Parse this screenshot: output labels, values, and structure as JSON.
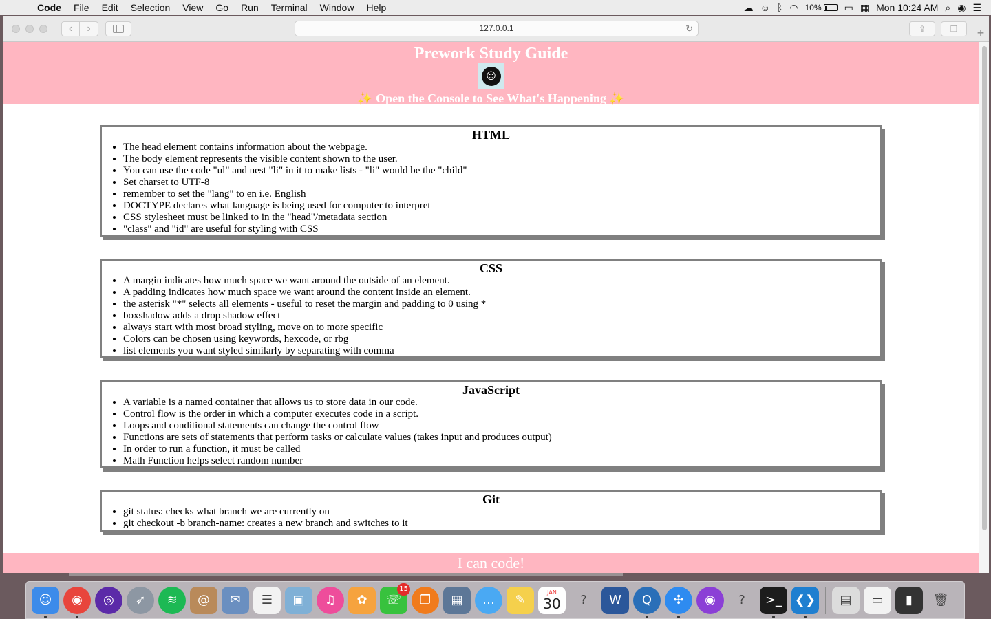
{
  "menubar": {
    "app_name": "Code",
    "menus": [
      "File",
      "Edit",
      "Selection",
      "View",
      "Go",
      "Run",
      "Terminal",
      "Window",
      "Help"
    ],
    "battery": "10%",
    "clock": "Mon 10:24 AM"
  },
  "browser": {
    "url": "127.0.0.1"
  },
  "page": {
    "title": "Prework Study Guide",
    "subtitle": "✨ Open the Console to See What's Happening ✨",
    "avatar_glyph": "☺",
    "sections": [
      {
        "heading": "HTML",
        "items": [
          "The head element contains information about the webpage.",
          "The body element represents the visible content shown to the user.",
          "You can use the code \"ul\" and nest \"li\" in it to make lists - \"li\" would be the \"child\"",
          "Set charset to UTF-8",
          "remember to set the \"lang\" to en i.e. English",
          "DOCTYPE declares what language is being used for computer to interpret",
          "CSS stylesheet must be linked to in the \"head\"/metadata section",
          "\"class\" and \"id\" are useful for styling with CSS"
        ]
      },
      {
        "heading": "CSS",
        "items": [
          "A margin indicates how much space we want around the outside of an element.",
          "A padding indicates how much space we want around the content inside an element.",
          "the asterisk \"*\" selects all elements - useful to reset the margin and padding to 0 using *",
          "boxshadow adds a drop shadow effect",
          "always start with most broad styling, move on to more specific",
          "Colors can be chosen using keywords, hexcode, or rbg",
          "list elements you want styled similarly by separating with comma"
        ]
      },
      {
        "heading": "JavaScript",
        "items": [
          "A variable is a named container that allows us to store data in our code.",
          "Control flow is the order in which a computer executes code in a script.",
          "Loops and conditional statements can change the control flow",
          "Functions are sets of statements that perform tasks or calculate values (takes input and produces output)",
          "In order to run a function, it must be called",
          "Math Function helps select random number"
        ]
      },
      {
        "heading": "Git",
        "items": [
          "git status: checks what branch we are currently on",
          "git checkout -b branch-name: creates a new branch and switches to it"
        ]
      }
    ],
    "footer": "I can code!"
  },
  "dock": {
    "messages_badge": "15",
    "calendar_month": "JAN",
    "calendar_day": "30",
    "items": [
      {
        "name": "finder-icon",
        "glyph": "☺",
        "bg": "#3c8bea",
        "running": true
      },
      {
        "name": "chrome-icon",
        "glyph": "◉",
        "bg": "#e8453c",
        "running": true,
        "round": true
      },
      {
        "name": "siri-icon",
        "glyph": "◎",
        "bg": "#5b2aa8",
        "running": false,
        "round": true
      },
      {
        "name": "launchpad-icon",
        "glyph": "➶",
        "bg": "#8d97a3",
        "running": false,
        "round": true
      },
      {
        "name": "spotify-icon",
        "glyph": "≋",
        "bg": "#1db954",
        "running": false,
        "round": true
      },
      {
        "name": "contacts-icon",
        "glyph": "@",
        "bg": "#b98a5a",
        "running": false
      },
      {
        "name": "mail-icon",
        "glyph": "✉",
        "bg": "#6a8fc0",
        "running": false
      },
      {
        "name": "reminders-icon",
        "glyph": "☰",
        "bg": "#f2f2f2",
        "running": false
      },
      {
        "name": "preview-icon",
        "glyph": "▣",
        "bg": "#7fb0d6",
        "running": false
      },
      {
        "name": "itunes-icon",
        "glyph": "♫",
        "bg": "#ee4d9b",
        "running": false,
        "round": true
      },
      {
        "name": "photos-icon",
        "glyph": "✿",
        "bg": "#f6a33e",
        "running": false
      },
      {
        "name": "messages-icon",
        "glyph": "☏",
        "bg": "#38c23e",
        "running": false
      },
      {
        "name": "ibooks-icon",
        "glyph": "❐",
        "bg": "#f07b1c",
        "running": false,
        "round": true
      },
      {
        "name": "image-capture-icon",
        "glyph": "▦",
        "bg": "#5d7797",
        "running": false
      },
      {
        "name": "messages-bubble-icon",
        "glyph": "…",
        "bg": "#4aa9f3",
        "running": false,
        "round": true
      },
      {
        "name": "notes-icon",
        "glyph": "✎",
        "bg": "#f5d04c",
        "running": false
      },
      {
        "name": "calendar-icon",
        "glyph": "",
        "bg": "#ffffff",
        "running": false
      },
      {
        "name": "unknown-app-icon",
        "glyph": "?",
        "bg": "transparent",
        "running": false
      },
      {
        "name": "word-icon",
        "glyph": "W",
        "bg": "#2b579a",
        "running": false
      },
      {
        "name": "quicktime-icon",
        "glyph": "Q",
        "bg": "#2a6fb8",
        "running": true,
        "round": true
      },
      {
        "name": "safari-icon",
        "glyph": "✣",
        "bg": "#2e8bf0",
        "running": true,
        "round": true
      },
      {
        "name": "podcasts-icon",
        "glyph": "◉",
        "bg": "#8b3fd6",
        "running": false,
        "round": true
      },
      {
        "name": "unknown-app-icon-2",
        "glyph": "?",
        "bg": "transparent",
        "running": false
      },
      {
        "name": "terminal-icon",
        "glyph": ">_",
        "bg": "#1c1c1c",
        "running": true
      },
      {
        "name": "vscode-icon",
        "glyph": "❮❯",
        "bg": "#1f7fd0",
        "running": true
      }
    ],
    "stack_items": [
      {
        "name": "downloads-stack-icon",
        "glyph": "▤",
        "bg": "#dcdcdc"
      },
      {
        "name": "screenshot-stack-icon",
        "glyph": "▭",
        "bg": "#f2f2f2"
      },
      {
        "name": "documents-stack-icon",
        "glyph": "▮",
        "bg": "#333333"
      },
      {
        "name": "trash-icon",
        "glyph": "🗑",
        "bg": "transparent"
      }
    ]
  }
}
